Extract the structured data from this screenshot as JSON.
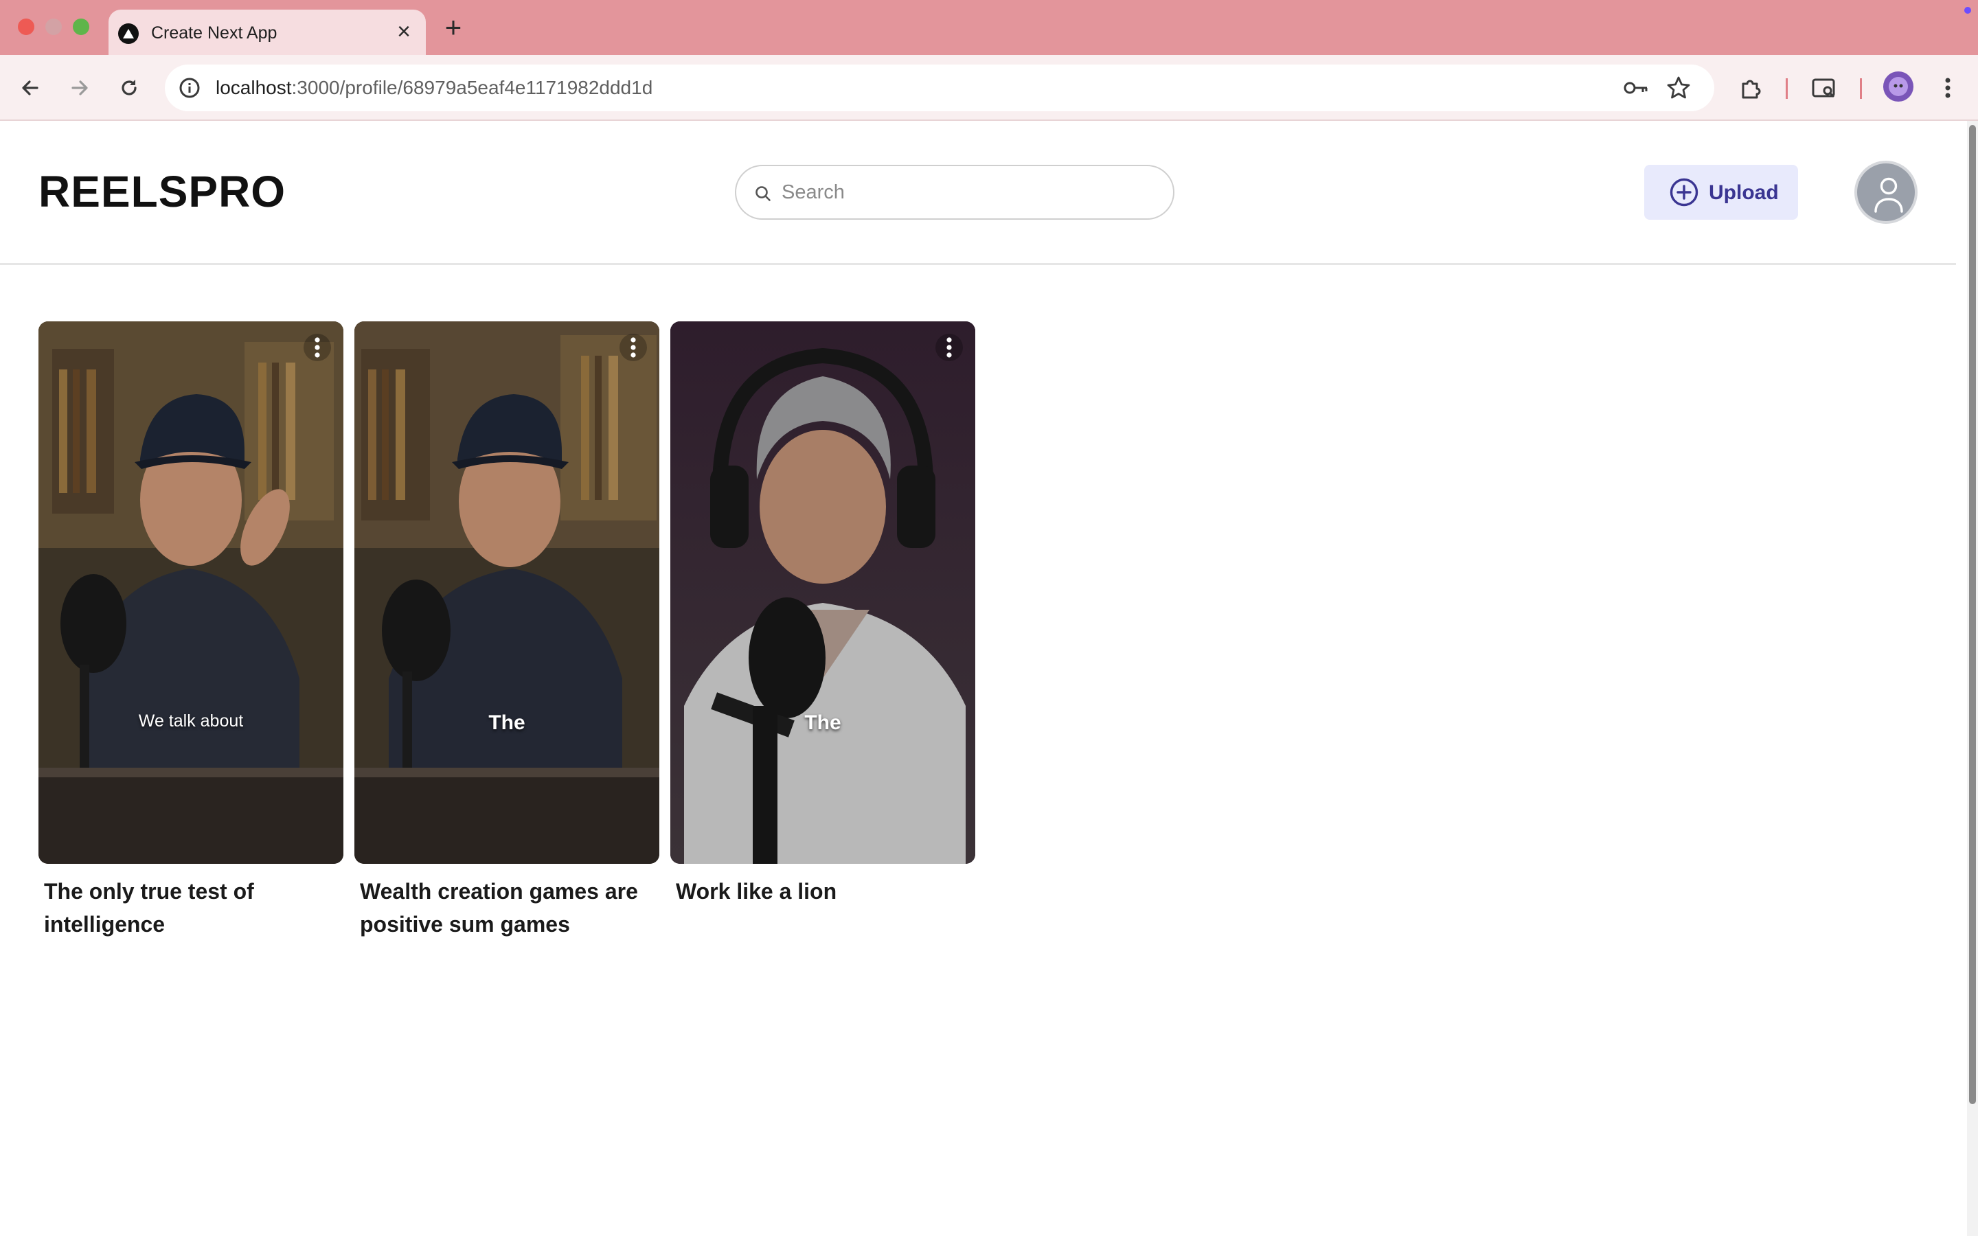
{
  "browser": {
    "tab_title": "Create Next App",
    "url_host": "localhost",
    "url_rest": ":3000/profile/68979a5eaf4e1171982ddd1d",
    "new_tab_symbol": "+",
    "close_symbol": "×",
    "icons": [
      "back-icon",
      "forward-icon",
      "reload-icon",
      "site-info-icon",
      "password-key-icon",
      "bookmark-star-icon",
      "extensions-icon",
      "tab-search-icon",
      "profile-icon",
      "more-menu-icon"
    ]
  },
  "header": {
    "logo": "REELSPRO",
    "search_placeholder": "Search",
    "upload_label": "Upload"
  },
  "videos": [
    {
      "title": "The only true test of intelligence",
      "caption": "We talk about"
    },
    {
      "title": "Wealth creation games are positive sum games",
      "caption": "The"
    },
    {
      "title": "Work like a lion",
      "caption": "The"
    }
  ],
  "colors": {
    "tabbar": "#e3959b",
    "upload_bg": "#e8eafc",
    "upload_text": "#3a3592",
    "avatar": "#9aa0aa"
  }
}
